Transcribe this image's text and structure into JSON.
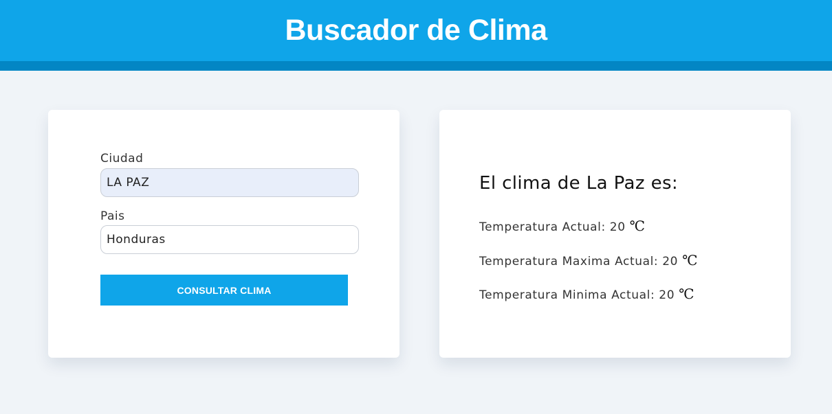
{
  "header": {
    "title": "Buscador de Clima"
  },
  "form": {
    "city_label": "Ciudad",
    "city_value": "LA PAZ",
    "country_label": "Pais",
    "country_value": "Honduras",
    "submit_label": "CONSULTAR CLIMA"
  },
  "result": {
    "title": "El clima de La Paz es:",
    "current_label": "Temperatura Actual: 20",
    "max_label": "Temperatura Maxima Actual: 20",
    "min_label": "Temperatura Minima Actual: 20",
    "unit": "℃"
  },
  "colors": {
    "primary": "#0fa5e9",
    "primary_dark": "#0386c4",
    "background": "#f0f4f8"
  }
}
